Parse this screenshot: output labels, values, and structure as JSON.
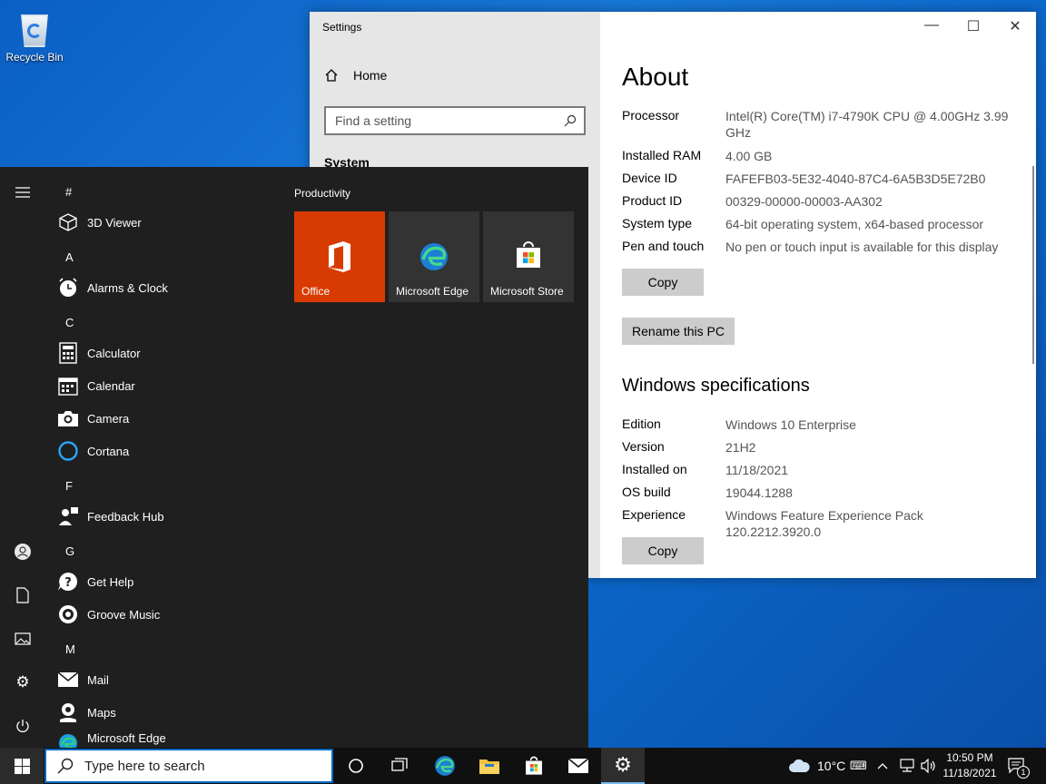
{
  "desktop": {
    "recycle_bin_label": "Recycle Bin"
  },
  "settings": {
    "window_title": "Settings",
    "home_label": "Home",
    "search_placeholder": "Find a setting",
    "section_label": "System",
    "about_heading": "About",
    "device_specs": [
      {
        "key": "Processor",
        "value": "Intel(R) Core(TM) i7-4790K CPU @ 4.00GHz   3.99 GHz"
      },
      {
        "key": "Installed RAM",
        "value": "4.00 GB"
      },
      {
        "key": "Device ID",
        "value": "FAFEFB03-5E32-4040-87C4-6A5B3D5E72B0"
      },
      {
        "key": "Product ID",
        "value": "00329-00000-00003-AA302"
      },
      {
        "key": "System type",
        "value": "64-bit operating system, x64-based processor"
      },
      {
        "key": "Pen and touch",
        "value": "No pen or touch input is available for this display"
      }
    ],
    "copy_label": "Copy",
    "rename_label": "Rename this PC",
    "windows_spec_heading": "Windows specifications",
    "windows_specs": [
      {
        "key": "Edition",
        "value": "Windows 10 Enterprise"
      },
      {
        "key": "Version",
        "value": "21H2"
      },
      {
        "key": "Installed on",
        "value": "11/18/2021"
      },
      {
        "key": "OS build",
        "value": "19044.1288"
      },
      {
        "key": "Experience",
        "value": "Windows Feature Experience Pack 120.2212.3920.0"
      }
    ],
    "copy2_label": "Copy"
  },
  "start_menu": {
    "groups": [
      {
        "letter": "#",
        "apps": [
          {
            "name": "3D Viewer",
            "icon": "cube-icon"
          }
        ]
      },
      {
        "letter": "A",
        "apps": [
          {
            "name": "Alarms & Clock",
            "icon": "alarm-clock-icon"
          }
        ]
      },
      {
        "letter": "C",
        "apps": [
          {
            "name": "Calculator",
            "icon": "calculator-icon"
          },
          {
            "name": "Calendar",
            "icon": "calendar-icon"
          },
          {
            "name": "Camera",
            "icon": "camera-icon"
          },
          {
            "name": "Cortana",
            "icon": "cortana-icon"
          }
        ]
      },
      {
        "letter": "F",
        "apps": [
          {
            "name": "Feedback Hub",
            "icon": "feedback-icon"
          }
        ]
      },
      {
        "letter": "G",
        "apps": [
          {
            "name": "Get Help",
            "icon": "help-icon"
          },
          {
            "name": "Groove Music",
            "icon": "music-icon"
          }
        ]
      },
      {
        "letter": "M",
        "apps": [
          {
            "name": "Mail",
            "icon": "mail-icon"
          },
          {
            "name": "Maps",
            "icon": "maps-icon"
          },
          {
            "name": "Microsoft Edge",
            "icon": "edge-icon"
          }
        ]
      }
    ],
    "tiles_heading": "Productivity",
    "tiles": [
      {
        "label": "Office",
        "color": "#d83b01"
      },
      {
        "label": "Microsoft Edge",
        "color": "#333333"
      },
      {
        "label": "Microsoft Store",
        "color": "#333333"
      }
    ]
  },
  "taskbar": {
    "search_placeholder": "Type here to search",
    "weather": "10°C",
    "time": "10:50 PM",
    "date": "11/18/2021",
    "notification_count": "1"
  }
}
